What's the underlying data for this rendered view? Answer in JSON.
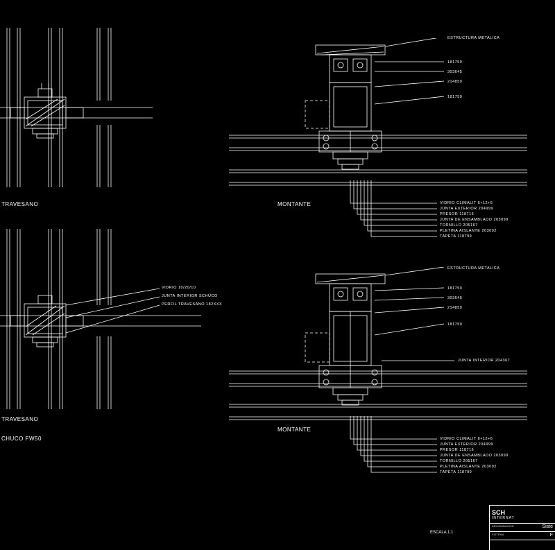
{
  "labels": {
    "travesano": "TRAVESANO",
    "montante": "MONTANTE",
    "system": "CHUCO FW50"
  },
  "left_middle_callouts": [
    "VIDRIO 10/20/10",
    "JUNTA INTERIOR SCHÜCO",
    "PERFIL TRAVESANO 182XXX"
  ],
  "top_right_upper_callouts": [
    "ESTRUCTURA METALICA",
    "181750",
    "303645",
    "214850",
    "181750"
  ],
  "top_right_lower_callouts": [
    "VIDRIO CLIMALIT 6+12+6",
    "JUNTA EXTERIOR 204999",
    "PRESOR 118716",
    "JUNTA DE ENSAMBLADO 203099",
    "TORNILLO 205167",
    "PLETINA AISLANTE 203092",
    "TAPETA 118799"
  ],
  "bottom_right_upper_callouts": [
    "ESTRUCTURA METALICA",
    "181750",
    "303645",
    "214850",
    "181750"
  ],
  "bottom_right_mid_callout": "JUNTA INTERIOR 204367",
  "bottom_right_lower_callouts": [
    "VIDRIO CLIMALIT 6+12+6",
    "JUNTA EXTERIOR 204999",
    "PRESOR 118716",
    "JUNTA DE ENSAMBLADO 203099",
    "TORNILLO 205167",
    "PLETINA AISLANTE 203092",
    "TAPETA 118799"
  ],
  "titleblock": {
    "brand": "SCH",
    "brand_sub": "INTERNAT",
    "row1_label": "DENOMINACION",
    "row1_value": "Siste",
    "row2_label": "SISTEMA",
    "row2_value": "F"
  },
  "scale": "ESCALA  1:1"
}
